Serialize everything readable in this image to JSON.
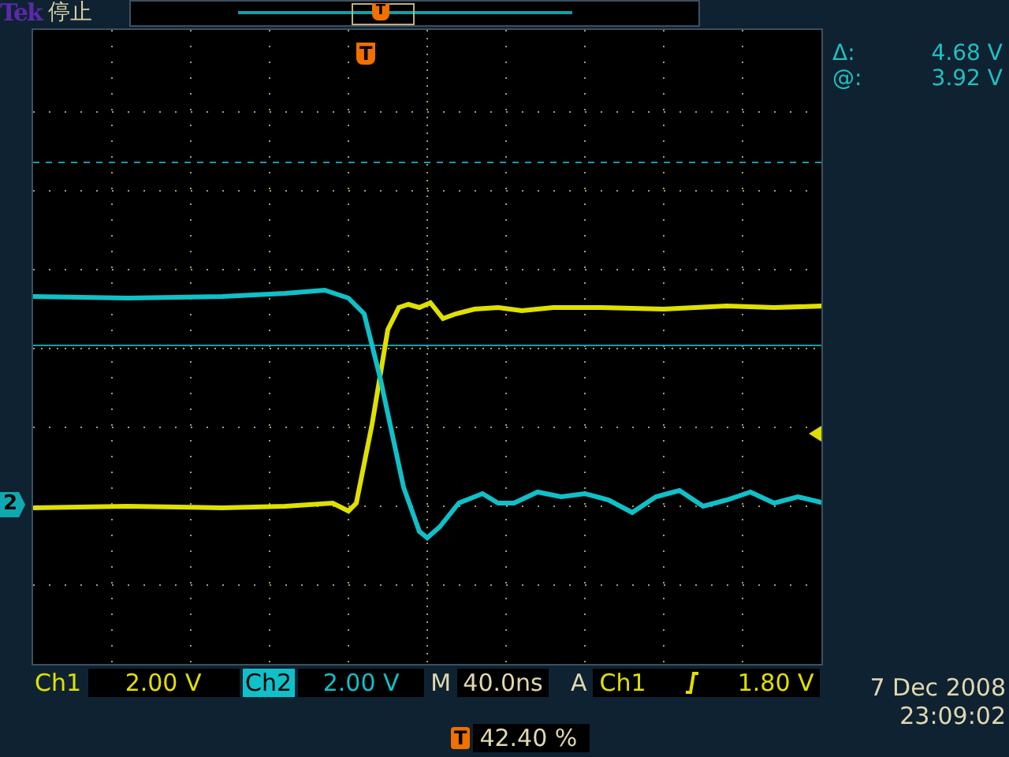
{
  "header": {
    "brand": "Tek",
    "status": "停止",
    "record_marker": "T"
  },
  "graticule": {
    "trigger_marker": "T",
    "ground_marker": "2"
  },
  "cursor_readout": [
    {
      "label": "Δ:",
      "value": "4.68 V"
    },
    {
      "label": "@:",
      "value": "3.92 V"
    }
  ],
  "channels": [
    {
      "label": "Ch1",
      "scale": "2.00 V",
      "selected": false,
      "color": "#e0e000"
    },
    {
      "label": "Ch2",
      "scale": "2.00 V",
      "selected": true,
      "color": "#10c0c8"
    }
  ],
  "timebase": {
    "label": "M",
    "value": "40.0ns"
  },
  "trigger": {
    "label": "A",
    "source": "Ch1",
    "level": "1.80 V"
  },
  "trigger_position": {
    "marker": "T",
    "value": "42.40 %"
  },
  "date": "7 Dec 2008",
  "time": "23:09:02"
}
